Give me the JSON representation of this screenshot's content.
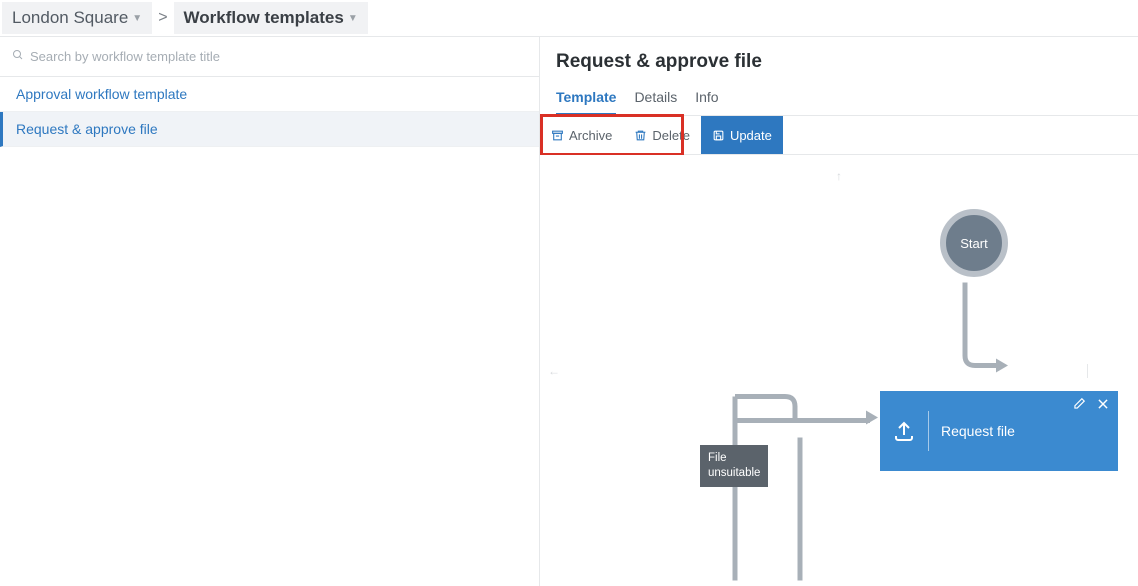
{
  "breadcrumb": {
    "org": "London Square",
    "page": "Workflow templates"
  },
  "search": {
    "placeholder": "Search by workflow template title"
  },
  "templates": [
    {
      "name": "Approval workflow template"
    },
    {
      "name": "Request & approve file"
    }
  ],
  "detail": {
    "title": "Request & approve file",
    "tabs": {
      "template": "Template",
      "details": "Details",
      "info": "Info"
    },
    "actions": {
      "archive": "Archive",
      "delete": "Delete",
      "update": "Update"
    }
  },
  "flow": {
    "start": "Start",
    "request_file": "Request file",
    "unsuitable": "File unsuitable"
  }
}
